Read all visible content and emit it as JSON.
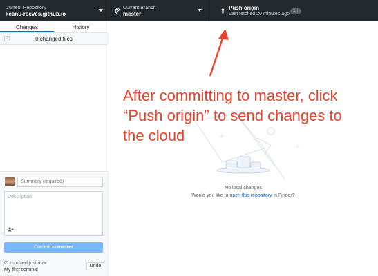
{
  "toolbar": {
    "repo": {
      "label": "Current Repository",
      "value": "keanu-reeves.github.io"
    },
    "branch": {
      "label": "Current Branch",
      "value": "master"
    },
    "push": {
      "label": "Push origin",
      "sub": "Last fetched 20 minutes ago",
      "badge": "1 ↑"
    }
  },
  "sidebar": {
    "tabs": [
      {
        "label": "Changes"
      },
      {
        "label": "History"
      }
    ],
    "changed_files": "0 changed files",
    "summary_placeholder": "Summary (required)",
    "description_placeholder": "Description",
    "commit_button_prefix": "Commit to ",
    "commit_button_branch": "master",
    "last_commit_time": "Committed just now",
    "last_commit_message": "My first commit!",
    "undo_label": "Undo"
  },
  "main": {
    "no_changes": "No local changes",
    "open_prefix": "Would you like to ",
    "open_link": "open this repository",
    "open_suffix": " in Finder?"
  },
  "annotation": {
    "text": "After committing to master, click “Push origin” to send changes to the cloud",
    "color": "#e8432c"
  },
  "colors": {
    "toolbar_bg": "#24292e",
    "accent": "#0366d6",
    "commit_button": "#79b8ff"
  },
  "icons": [
    "caret-down-icon",
    "branch-icon",
    "push-up-arrow-icon",
    "checkbox-icon",
    "add-coauthor-icon"
  ]
}
